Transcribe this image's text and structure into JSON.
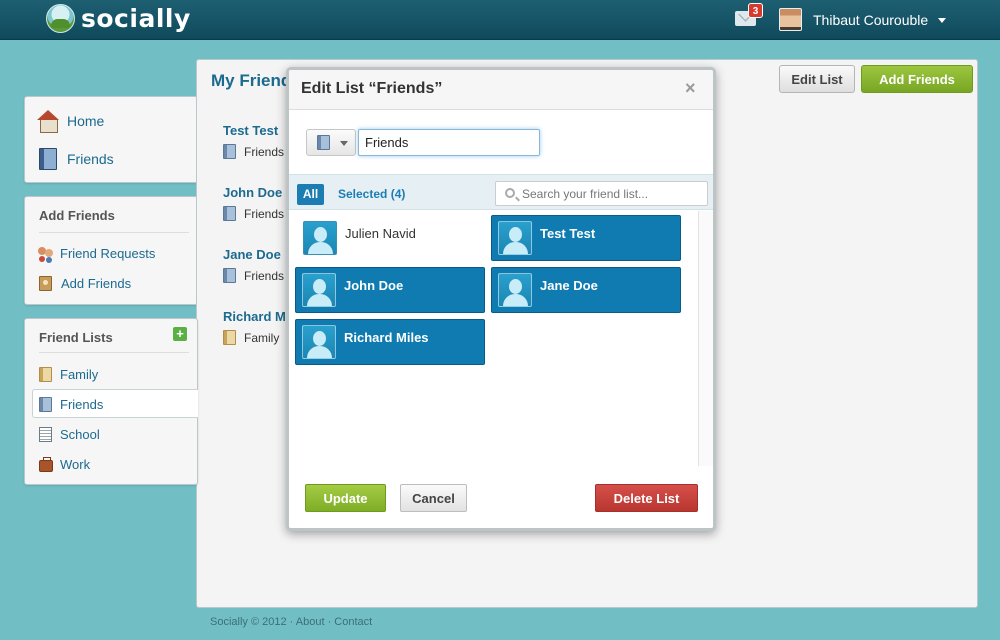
{
  "app": {
    "name": "socially"
  },
  "topbar": {
    "notification_count": "3",
    "username": "Thibaut Courouble"
  },
  "sidebar": {
    "nav": [
      {
        "label": "Home",
        "icon": "home-icon"
      },
      {
        "label": "Friends",
        "icon": "address-book-icon"
      }
    ],
    "add_friends": {
      "title": "Add Friends",
      "items": [
        {
          "label": "Friend Requests",
          "icon": "people-icon"
        },
        {
          "label": "Add Friends",
          "icon": "contact-book-icon"
        }
      ]
    },
    "friend_lists": {
      "title": "Friend Lists",
      "add_symbol": "+",
      "items": [
        {
          "label": "Family",
          "icon": "tan-book-icon"
        },
        {
          "label": "Friends",
          "icon": "blue-book-icon",
          "active": true
        },
        {
          "label": "School",
          "icon": "notebook-icon"
        },
        {
          "label": "Work",
          "icon": "briefcase-icon"
        }
      ]
    }
  },
  "main": {
    "title": "My Friends",
    "edit_button": "Edit List",
    "add_button": "Add Friends",
    "people": [
      {
        "name": "Test Test",
        "list": "Friends"
      },
      {
        "name": "John Doe",
        "list": "Friends"
      },
      {
        "name": "Jane Doe",
        "list": "Friends"
      },
      {
        "name": "Richard Miles",
        "list": "Family"
      }
    ]
  },
  "footer": {
    "text": "Socially © 2012 · About · Contact"
  },
  "modal": {
    "title": "Edit List “Friends”",
    "close": "×",
    "list_name": "Friends",
    "tab_all": "All",
    "tab_selected": "Selected (4)",
    "search_placeholder": "Search your friend list...",
    "friends": [
      {
        "name": "Julien Navid",
        "selected": false
      },
      {
        "name": "Test Test",
        "selected": true
      },
      {
        "name": "John Doe",
        "selected": true
      },
      {
        "name": "Jane Doe",
        "selected": true
      },
      {
        "name": "Richard Miles",
        "selected": true
      }
    ],
    "update_button": "Update",
    "cancel_button": "Cancel",
    "delete_button": "Delete List"
  },
  "colors": {
    "background": "#71bfc5",
    "topbar": "#0f4a5c",
    "link": "#1c6a8f",
    "selected_tile": "#0f7bb0",
    "primary_green": "#7fad27",
    "danger_red": "#b93630"
  }
}
